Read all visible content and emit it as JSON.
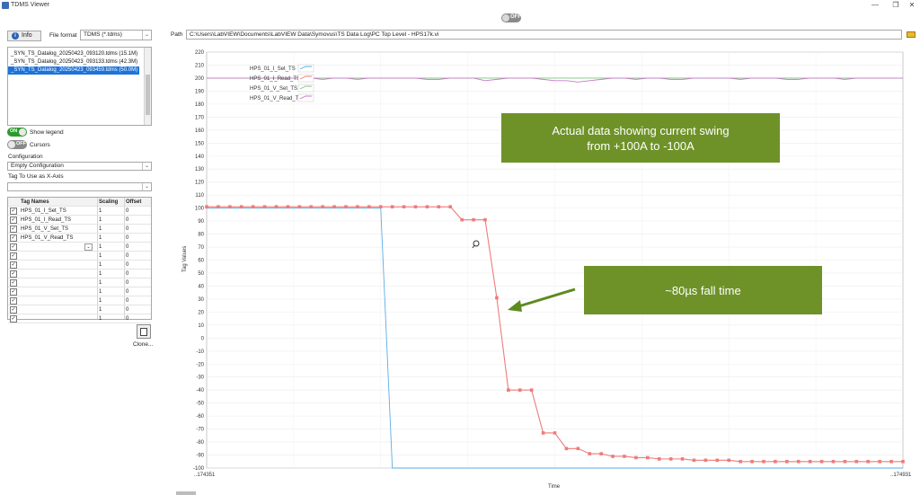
{
  "window": {
    "title": "TDMS Viewer",
    "min": "—",
    "max": "❐",
    "close": "✕"
  },
  "top_toggle": {
    "label": "OFF"
  },
  "info_button": {
    "icon": "info-icon",
    "label": "Info"
  },
  "file_format": {
    "label": "File format",
    "value": "TDMS (*.tdms)"
  },
  "files": [
    "_SYN_TS_Datalog_20250423_093120.tdms (15.1M)",
    "_SYN_TS_Datalog_20250423_093133.tdms (42.3M)",
    "_SYN_TS_Datalog_20250423_093459.tdms (50.0M)"
  ],
  "show_legend": {
    "state": "ON",
    "label": "Show legend"
  },
  "cursors": {
    "state": "OFF",
    "label": "Cursors"
  },
  "configuration": {
    "label": "Configuration",
    "value": "Empty Configuration"
  },
  "xaxis_tag": {
    "label": "Tag To Use as X-Axis",
    "value": ""
  },
  "tag_table": {
    "headers": [
      "Tag Names",
      "Scaling",
      "Offset"
    ],
    "rows": [
      {
        "name": "HPS_01_I_Set_TS",
        "scaling": "1",
        "offset": "0"
      },
      {
        "name": "HPS_01_I_Read_TS",
        "scaling": "1",
        "offset": "0"
      },
      {
        "name": "HPS_01_V_Set_TS",
        "scaling": "1",
        "offset": "0"
      },
      {
        "name": "HPS_01_V_Read_TS",
        "scaling": "1",
        "offset": "0"
      },
      {
        "name": "",
        "scaling": "1",
        "offset": "0"
      },
      {
        "name": "",
        "scaling": "1",
        "offset": "0"
      },
      {
        "name": "",
        "scaling": "1",
        "offset": "0"
      },
      {
        "name": "",
        "scaling": "1",
        "offset": "0"
      },
      {
        "name": "",
        "scaling": "1",
        "offset": "0"
      },
      {
        "name": "",
        "scaling": "1",
        "offset": "0"
      },
      {
        "name": "",
        "scaling": "1",
        "offset": "0"
      },
      {
        "name": "",
        "scaling": "1",
        "offset": "0"
      },
      {
        "name": "",
        "scaling": "1",
        "offset": "0"
      }
    ]
  },
  "clone": {
    "label": "Clone..."
  },
  "path": {
    "label": "Path",
    "value": "C:\\Users\\LabVIEW\\Documents\\LabVIEW Data\\Symovus\\TS Data Log\\PC Top Level - HPS17k.vi"
  },
  "chart_data": {
    "type": "line",
    "xlabel": "Time",
    "ylabel": "Tag Values",
    "x_tick_labels": [
      "..174351",
      "..174931"
    ],
    "ylim": [
      -100,
      220
    ],
    "ytick_step": 10,
    "x_count": 61,
    "colors": {
      "I_Set": "#5aaee6",
      "I_Read": "#ee7b7b",
      "V_Set": "#7cc67c",
      "V_Read": "#c77ac7"
    },
    "legend": {
      "position": "top-left",
      "entries": [
        "HPS_01_I_Set_TS",
        "HPS_01_I_Read_TS",
        "HPS_01_V_Set_TS",
        "HPS_01_V_Read_TS"
      ]
    },
    "series": [
      {
        "name": "HPS_01_I_Set_TS",
        "key": "I_Set",
        "values": [
          100,
          100,
          100,
          100,
          100,
          100,
          100,
          100,
          100,
          100,
          100,
          100,
          100,
          100,
          100,
          100,
          -100,
          -100,
          -100,
          -100,
          -100,
          -100,
          -100,
          -100,
          -100,
          -100,
          -100,
          -100,
          -100,
          -100,
          -100,
          -100,
          -100,
          -100,
          -100,
          -100,
          -100,
          -100,
          -100,
          -100,
          -100,
          -100,
          -100,
          -100,
          -100,
          -100,
          -100,
          -100,
          -100,
          -100,
          -100,
          -100,
          -100,
          -100,
          -100,
          -100,
          -100,
          -100,
          -100,
          -100,
          -100
        ]
      },
      {
        "name": "HPS_01_I_Read_TS",
        "key": "I_Read",
        "values": [
          101,
          101,
          101,
          101,
          101,
          101,
          101,
          101,
          101,
          101,
          101,
          101,
          101,
          101,
          101,
          101,
          101,
          101,
          101,
          101,
          101,
          101,
          91,
          91,
          91,
          31,
          -40,
          -40,
          -40,
          -73,
          -73,
          -85,
          -85,
          -89,
          -89,
          -91,
          -91,
          -92,
          -92,
          -93,
          -93,
          -93,
          -94,
          -94,
          -94,
          -94,
          -95,
          -95,
          -95,
          -95,
          -95,
          -95,
          -95,
          -95,
          -95,
          -95,
          -95,
          -95,
          -95,
          -95,
          -95
        ]
      },
      {
        "name": "HPS_01_V_Set_TS",
        "key": "V_Set",
        "values": [
          200,
          200,
          200,
          200,
          200,
          200,
          200,
          200,
          200,
          200,
          200,
          200,
          200,
          200,
          200,
          200,
          200,
          200,
          200,
          200,
          200,
          200,
          200,
          200,
          200,
          200,
          200,
          200,
          200,
          200,
          200,
          200,
          200,
          200,
          200,
          200,
          200,
          200,
          200,
          200,
          200,
          200,
          200,
          200,
          200,
          200,
          200,
          200,
          200,
          200,
          200,
          200,
          200,
          200,
          200,
          200,
          200,
          200,
          200,
          200,
          200
        ]
      },
      {
        "name": "HPS_01_V_Read_TS",
        "key": "V_Read",
        "values": [
          200,
          200,
          200,
          200,
          200,
          200,
          200,
          200,
          200,
          200,
          199,
          200,
          200,
          199,
          200,
          200,
          200,
          200,
          200,
          199,
          199,
          200,
          200,
          200,
          198,
          199,
          200,
          200,
          200,
          199,
          198,
          198,
          197,
          198,
          199,
          200,
          200,
          199,
          200,
          200,
          199,
          199,
          200,
          200,
          200,
          200,
          199,
          200,
          200,
          200,
          199,
          199,
          200,
          200,
          200,
          199,
          200,
          200,
          200,
          200,
          200
        ]
      }
    ]
  },
  "annotations": [
    {
      "text_line1": "Actual data showing current swing",
      "text_line2": "from +100A to -100A"
    },
    {
      "text": "~80µs fall time"
    }
  ]
}
